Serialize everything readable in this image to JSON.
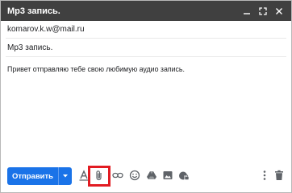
{
  "window": {
    "title": "Mp3 запись."
  },
  "fields": {
    "to": "komarov.k.w@mail.ru",
    "subject": "Mp3 запись."
  },
  "message": {
    "body": "Привет отправляю тебе свою любимую аудио запись."
  },
  "toolbar": {
    "send_label": "Отправить",
    "icons": [
      "formatting-icon",
      "attach-file-icon",
      "insert-link-icon",
      "emoji-icon",
      "google-drive-icon",
      "insert-photo-icon",
      "confidential-mode-icon",
      "more-options-icon",
      "delete-draft-icon"
    ]
  },
  "colors": {
    "titlebar": "#404040",
    "send_button": "#1a73e8",
    "highlight": "#e21b22"
  }
}
